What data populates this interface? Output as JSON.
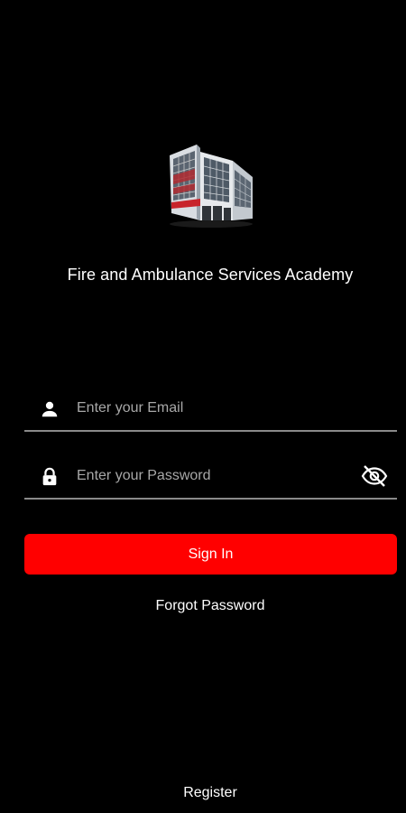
{
  "app": {
    "title": "Fire and Ambulance Services Academy",
    "logo_icon": "fire-station-building-icon"
  },
  "form": {
    "email": {
      "placeholder": "Enter your Email",
      "value": "",
      "icon": "person-icon"
    },
    "password": {
      "placeholder": "Enter your Password",
      "value": "",
      "icon": "lock-icon",
      "toggle_icon": "eye-off-icon"
    },
    "sign_in_label": "Sign In",
    "forgot_label": "Forgot Password"
  },
  "footer": {
    "register_label": "Register"
  },
  "colors": {
    "background": "#000000",
    "primary": "#ff0000",
    "text": "#ffffff",
    "placeholder": "#a8a8a8",
    "underline": "#8a8a8a"
  }
}
